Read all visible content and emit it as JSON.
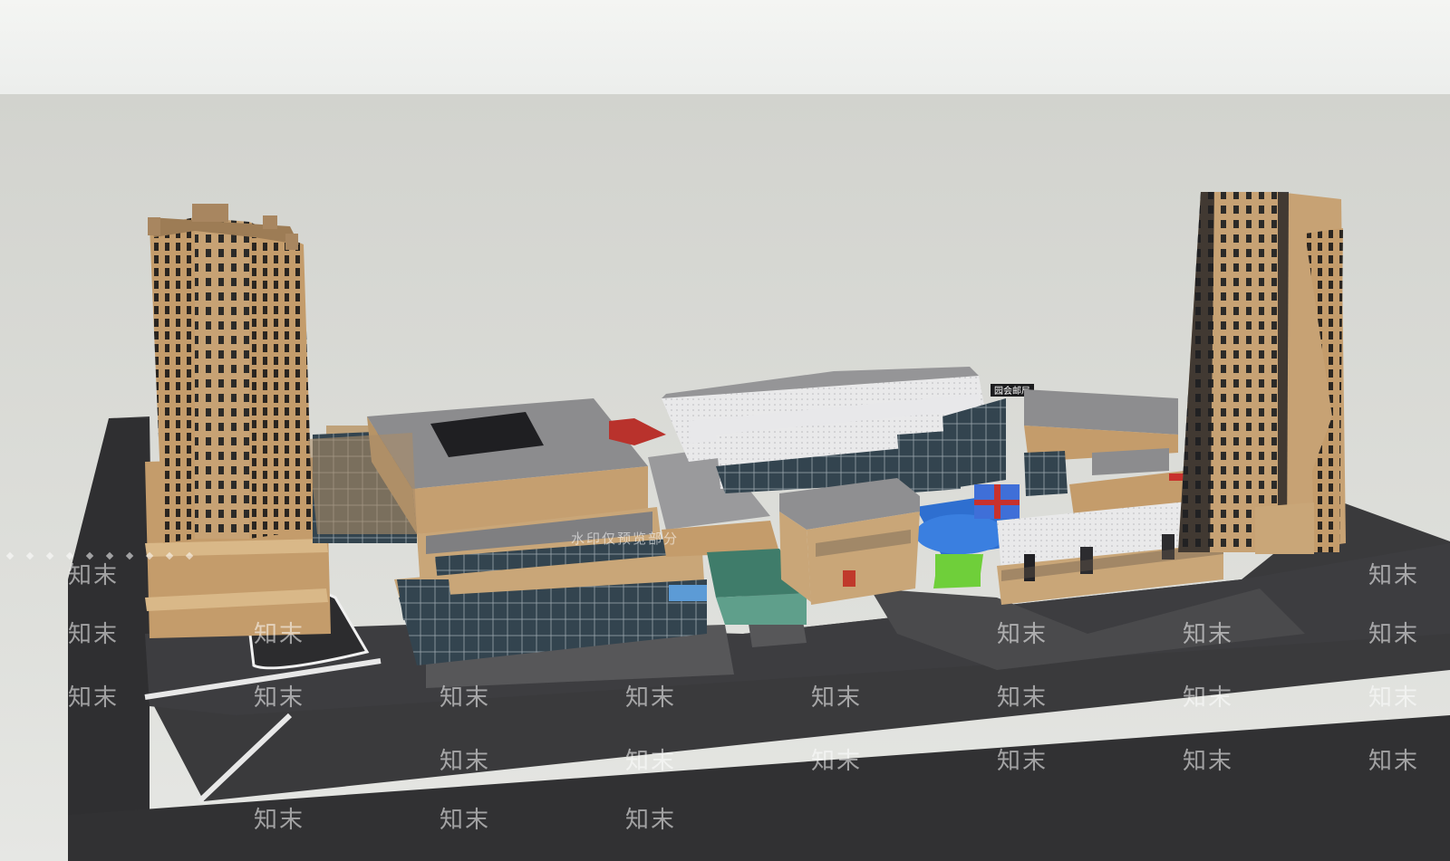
{
  "scene": {
    "sign_main": "园会邮局",
    "watermark_text": "知末",
    "watermark_caption": "水印仅预览部分",
    "colors": {
      "sky": "#f2f3f1",
      "ground": "#d6d7d2",
      "road": "#3a3a3c",
      "facade": "#c8a77a",
      "roof": "#8e8e8e",
      "glass": "#2f3f4a",
      "accent_green": "#6fcf3a",
      "pool": "#2e6fd0"
    }
  }
}
